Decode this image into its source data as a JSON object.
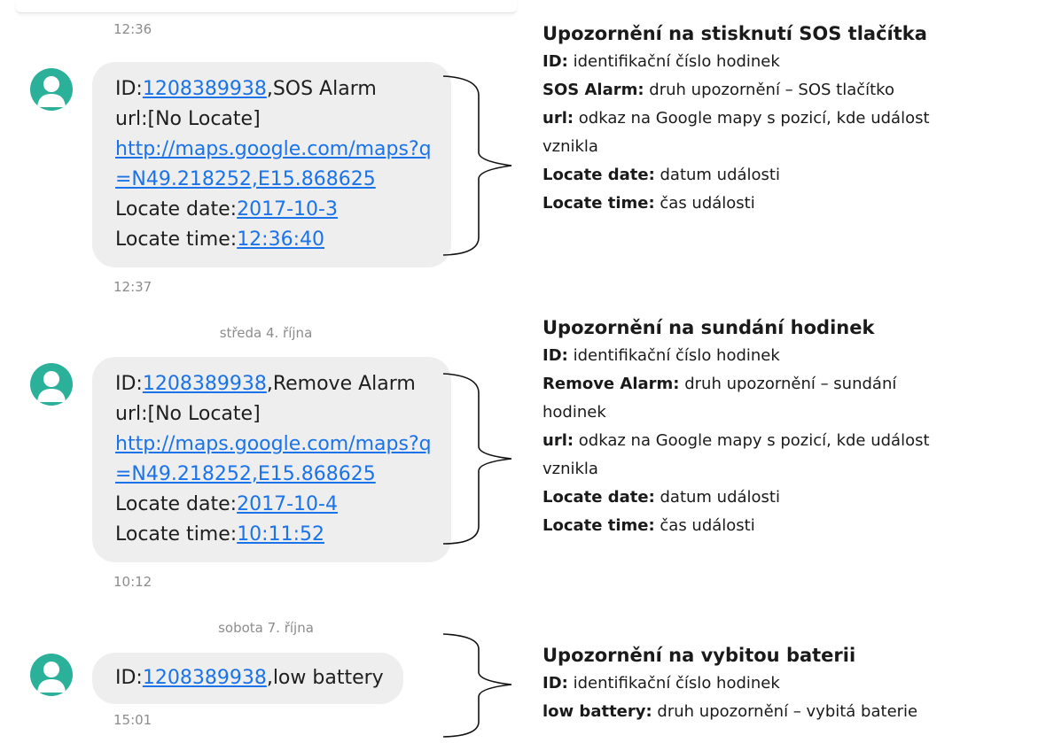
{
  "conversation": {
    "timestamps": [
      "12:36",
      "12:37",
      "10:12",
      "15:01"
    ],
    "dates": [
      "středa 4. října",
      "sobota 7. října"
    ],
    "messages": [
      {
        "id_prefix": "ID:",
        "id_link": "1208389938",
        "type": ",SOS Alarm",
        "url_label": "url:[No Locate]",
        "url_line1": "http://maps.google.com/maps?q",
        "url_line2": "=N49.218252,E15.868625",
        "date_label": "Locate date:",
        "date_value": "2017-10-3",
        "time_label": "Locate time:",
        "time_value": "12:36:40"
      },
      {
        "id_prefix": "ID:",
        "id_link": "1208389938",
        "type": ",Remove Alarm",
        "url_label": "url:[No Locate]",
        "url_line1": "http://maps.google.com/maps?q",
        "url_line2": "=N49.218252,E15.868625",
        "date_label": "Locate date:",
        "date_value": "2017-10-4",
        "time_label": "Locate time:",
        "time_value": "10:11:52"
      },
      {
        "id_prefix": "ID:",
        "id_link": "1208389938",
        "type": ",low battery"
      }
    ]
  },
  "notes": [
    {
      "heading": "Upozornění na stisknutí SOS tlačítka",
      "items": [
        {
          "term": "ID:",
          "desc": " identifikační číslo hodinek"
        },
        {
          "term": "SOS Alarm:",
          "desc": " druh upozornění – SOS tlačítko"
        },
        {
          "term": "url:",
          "desc": " odkaz na Google mapy s pozicí, kde událost",
          "desc_cont": "vznikla"
        },
        {
          "term": "Locate date:",
          "desc": " datum události"
        },
        {
          "term": "Locate time:",
          "desc": " čas události"
        }
      ]
    },
    {
      "heading": "Upozornění na sundání hodinek",
      "items": [
        {
          "term": "ID:",
          "desc": " identifikační číslo hodinek"
        },
        {
          "term": "Remove Alarm:",
          "desc": " druh upozornění – sundání",
          "desc_cont": "hodinek"
        },
        {
          "term": "url:",
          "desc": " odkaz na Google mapy s pozicí, kde událost",
          "desc_cont": "vznikla"
        },
        {
          "term": "Locate date:",
          "desc": " datum události"
        },
        {
          "term": "Locate time:",
          "desc": " čas události"
        }
      ]
    },
    {
      "heading": "Upozornění na vybitou baterii",
      "items": [
        {
          "term": "ID:",
          "desc": " identifikační číslo hodinek"
        },
        {
          "term": "low battery:",
          "desc": " druh upozornění – vybitá baterie"
        }
      ]
    }
  ],
  "colors": {
    "avatar": "#2bb19a",
    "link": "#1a73e8",
    "bubble": "#eeeeee"
  }
}
